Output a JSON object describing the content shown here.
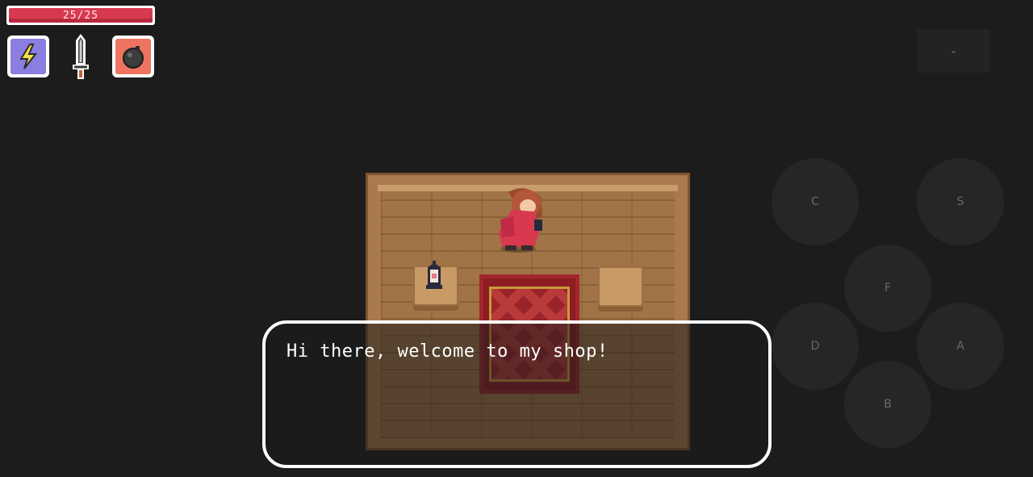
{
  "hud": {
    "health": {
      "current": 25,
      "max": 25,
      "text": "25/25"
    },
    "items": [
      {
        "name": "lightning",
        "icon": "lightning-icon",
        "color": "#8a7fe0"
      },
      {
        "name": "sword",
        "icon": "sword-icon"
      },
      {
        "name": "bomb",
        "icon": "bomb-icon",
        "color": "#ee7461"
      }
    ],
    "menu_label": "-"
  },
  "dialog": {
    "text": "Hi there, welcome to my shop!"
  },
  "controls": {
    "c": "C",
    "s": "S",
    "f": "F",
    "d": "D",
    "a": "A",
    "b": "B"
  },
  "colors": {
    "background": "#1c1c1c",
    "health": "#d8394f",
    "npc_robe": "#d8394f",
    "rug": "#8c1d22"
  }
}
